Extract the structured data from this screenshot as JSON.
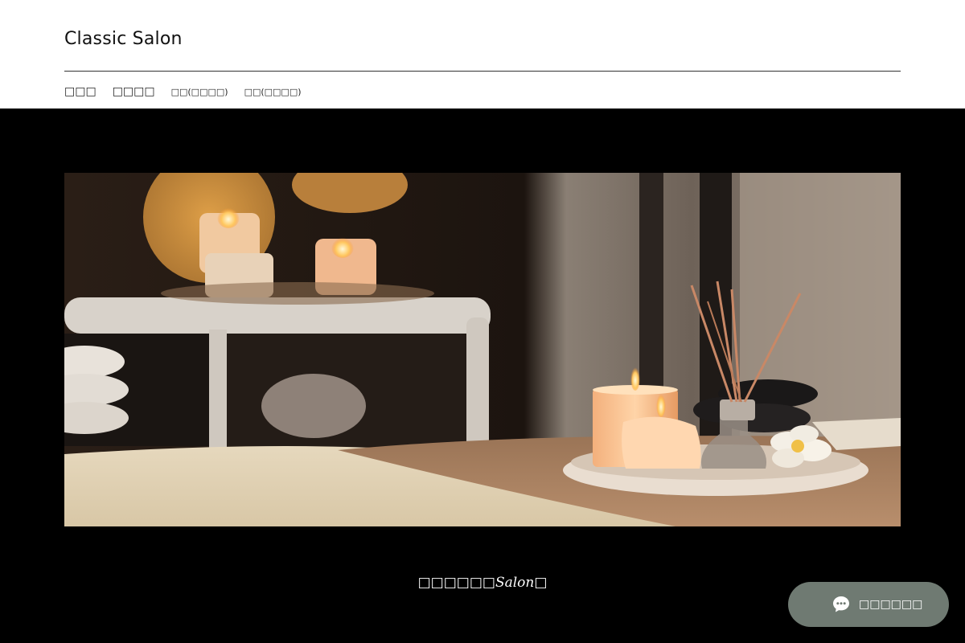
{
  "site": {
    "title": "Classic Salon"
  },
  "nav": {
    "items": [
      {
        "label": "□□□"
      },
      {
        "label": "□□□□"
      },
      {
        "label": "□□(□□□□)"
      },
      {
        "label": "□□(□□□□)"
      }
    ]
  },
  "hero": {
    "image_alt": "candles-spa-image",
    "caption_prefix": "□□□□□□",
    "caption_script": "Salon",
    "caption_suffix": "□"
  },
  "chat": {
    "label": "□□□□□□",
    "icon": "chat-bubble-icon",
    "bg_color": "#6f7a72"
  },
  "colors": {
    "header_bg": "#ffffff",
    "page_bg": "#000000",
    "text_dark": "#111111"
  }
}
